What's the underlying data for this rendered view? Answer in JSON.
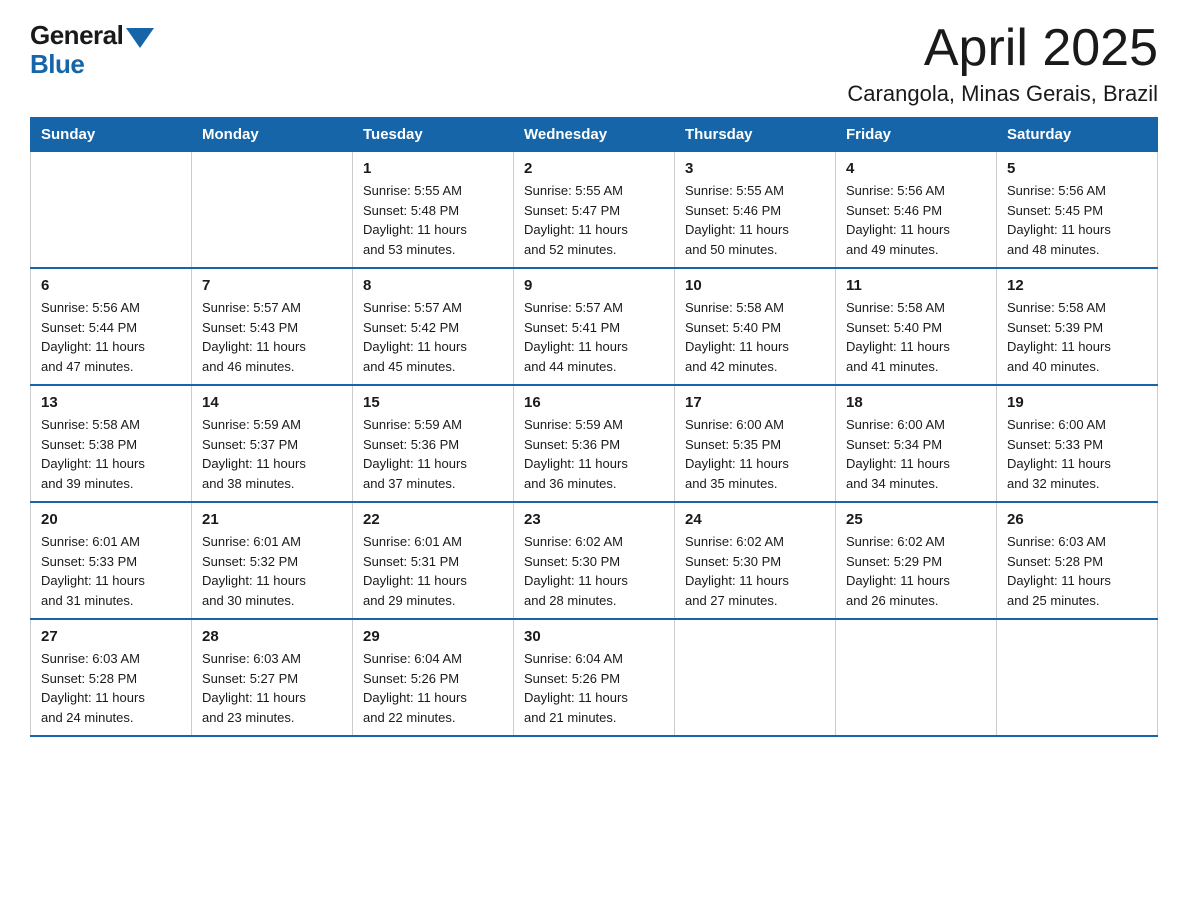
{
  "logo": {
    "general": "General",
    "blue": "Blue"
  },
  "title": "April 2025",
  "subtitle": "Carangola, Minas Gerais, Brazil",
  "weekdays": [
    "Sunday",
    "Monday",
    "Tuesday",
    "Wednesday",
    "Thursday",
    "Friday",
    "Saturday"
  ],
  "weeks": [
    [
      {
        "day": "",
        "info": ""
      },
      {
        "day": "",
        "info": ""
      },
      {
        "day": "1",
        "info": "Sunrise: 5:55 AM\nSunset: 5:48 PM\nDaylight: 11 hours\nand 53 minutes."
      },
      {
        "day": "2",
        "info": "Sunrise: 5:55 AM\nSunset: 5:47 PM\nDaylight: 11 hours\nand 52 minutes."
      },
      {
        "day": "3",
        "info": "Sunrise: 5:55 AM\nSunset: 5:46 PM\nDaylight: 11 hours\nand 50 minutes."
      },
      {
        "day": "4",
        "info": "Sunrise: 5:56 AM\nSunset: 5:46 PM\nDaylight: 11 hours\nand 49 minutes."
      },
      {
        "day": "5",
        "info": "Sunrise: 5:56 AM\nSunset: 5:45 PM\nDaylight: 11 hours\nand 48 minutes."
      }
    ],
    [
      {
        "day": "6",
        "info": "Sunrise: 5:56 AM\nSunset: 5:44 PM\nDaylight: 11 hours\nand 47 minutes."
      },
      {
        "day": "7",
        "info": "Sunrise: 5:57 AM\nSunset: 5:43 PM\nDaylight: 11 hours\nand 46 minutes."
      },
      {
        "day": "8",
        "info": "Sunrise: 5:57 AM\nSunset: 5:42 PM\nDaylight: 11 hours\nand 45 minutes."
      },
      {
        "day": "9",
        "info": "Sunrise: 5:57 AM\nSunset: 5:41 PM\nDaylight: 11 hours\nand 44 minutes."
      },
      {
        "day": "10",
        "info": "Sunrise: 5:58 AM\nSunset: 5:40 PM\nDaylight: 11 hours\nand 42 minutes."
      },
      {
        "day": "11",
        "info": "Sunrise: 5:58 AM\nSunset: 5:40 PM\nDaylight: 11 hours\nand 41 minutes."
      },
      {
        "day": "12",
        "info": "Sunrise: 5:58 AM\nSunset: 5:39 PM\nDaylight: 11 hours\nand 40 minutes."
      }
    ],
    [
      {
        "day": "13",
        "info": "Sunrise: 5:58 AM\nSunset: 5:38 PM\nDaylight: 11 hours\nand 39 minutes."
      },
      {
        "day": "14",
        "info": "Sunrise: 5:59 AM\nSunset: 5:37 PM\nDaylight: 11 hours\nand 38 minutes."
      },
      {
        "day": "15",
        "info": "Sunrise: 5:59 AM\nSunset: 5:36 PM\nDaylight: 11 hours\nand 37 minutes."
      },
      {
        "day": "16",
        "info": "Sunrise: 5:59 AM\nSunset: 5:36 PM\nDaylight: 11 hours\nand 36 minutes."
      },
      {
        "day": "17",
        "info": "Sunrise: 6:00 AM\nSunset: 5:35 PM\nDaylight: 11 hours\nand 35 minutes."
      },
      {
        "day": "18",
        "info": "Sunrise: 6:00 AM\nSunset: 5:34 PM\nDaylight: 11 hours\nand 34 minutes."
      },
      {
        "day": "19",
        "info": "Sunrise: 6:00 AM\nSunset: 5:33 PM\nDaylight: 11 hours\nand 32 minutes."
      }
    ],
    [
      {
        "day": "20",
        "info": "Sunrise: 6:01 AM\nSunset: 5:33 PM\nDaylight: 11 hours\nand 31 minutes."
      },
      {
        "day": "21",
        "info": "Sunrise: 6:01 AM\nSunset: 5:32 PM\nDaylight: 11 hours\nand 30 minutes."
      },
      {
        "day": "22",
        "info": "Sunrise: 6:01 AM\nSunset: 5:31 PM\nDaylight: 11 hours\nand 29 minutes."
      },
      {
        "day": "23",
        "info": "Sunrise: 6:02 AM\nSunset: 5:30 PM\nDaylight: 11 hours\nand 28 minutes."
      },
      {
        "day": "24",
        "info": "Sunrise: 6:02 AM\nSunset: 5:30 PM\nDaylight: 11 hours\nand 27 minutes."
      },
      {
        "day": "25",
        "info": "Sunrise: 6:02 AM\nSunset: 5:29 PM\nDaylight: 11 hours\nand 26 minutes."
      },
      {
        "day": "26",
        "info": "Sunrise: 6:03 AM\nSunset: 5:28 PM\nDaylight: 11 hours\nand 25 minutes."
      }
    ],
    [
      {
        "day": "27",
        "info": "Sunrise: 6:03 AM\nSunset: 5:28 PM\nDaylight: 11 hours\nand 24 minutes."
      },
      {
        "day": "28",
        "info": "Sunrise: 6:03 AM\nSunset: 5:27 PM\nDaylight: 11 hours\nand 23 minutes."
      },
      {
        "day": "29",
        "info": "Sunrise: 6:04 AM\nSunset: 5:26 PM\nDaylight: 11 hours\nand 22 minutes."
      },
      {
        "day": "30",
        "info": "Sunrise: 6:04 AM\nSunset: 5:26 PM\nDaylight: 11 hours\nand 21 minutes."
      },
      {
        "day": "",
        "info": ""
      },
      {
        "day": "",
        "info": ""
      },
      {
        "day": "",
        "info": ""
      }
    ]
  ]
}
